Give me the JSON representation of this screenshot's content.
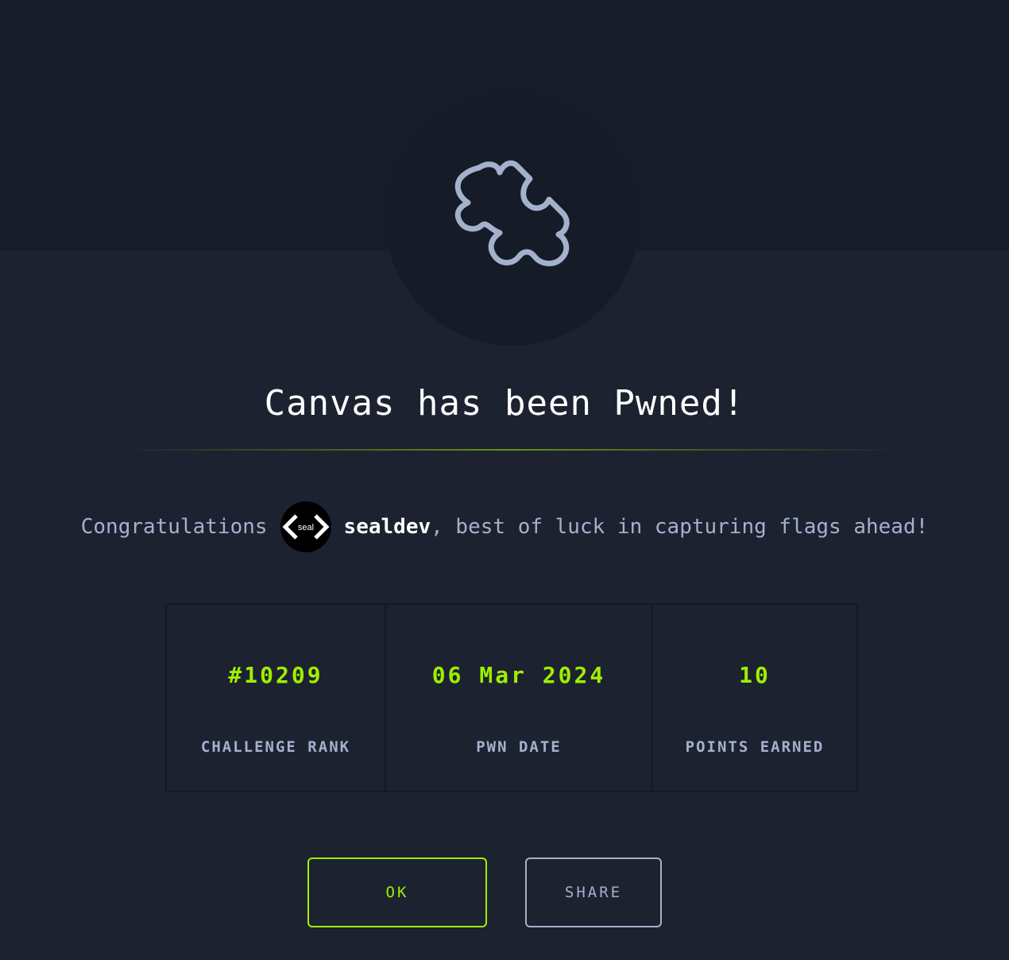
{
  "badge": {
    "icon": "puzzle-piece-icon"
  },
  "title": "Canvas has been Pwned!",
  "congrats": {
    "prefix": "Congratulations",
    "avatar_text": "seal",
    "username": "sealdev",
    "suffix": ", best of luck in capturing flags ahead!"
  },
  "stats": [
    {
      "value": "#10209",
      "label": "CHALLENGE RANK"
    },
    {
      "value": "06 Mar 2024",
      "label": "PWN DATE"
    },
    {
      "value": "10",
      "label": "POINTS EARNED"
    }
  ],
  "buttons": {
    "ok_label": "OK",
    "share_label": "SHARE"
  },
  "colors": {
    "accent": "#9fef00",
    "text_muted": "#a4b1cd",
    "background": "#1c2230"
  }
}
